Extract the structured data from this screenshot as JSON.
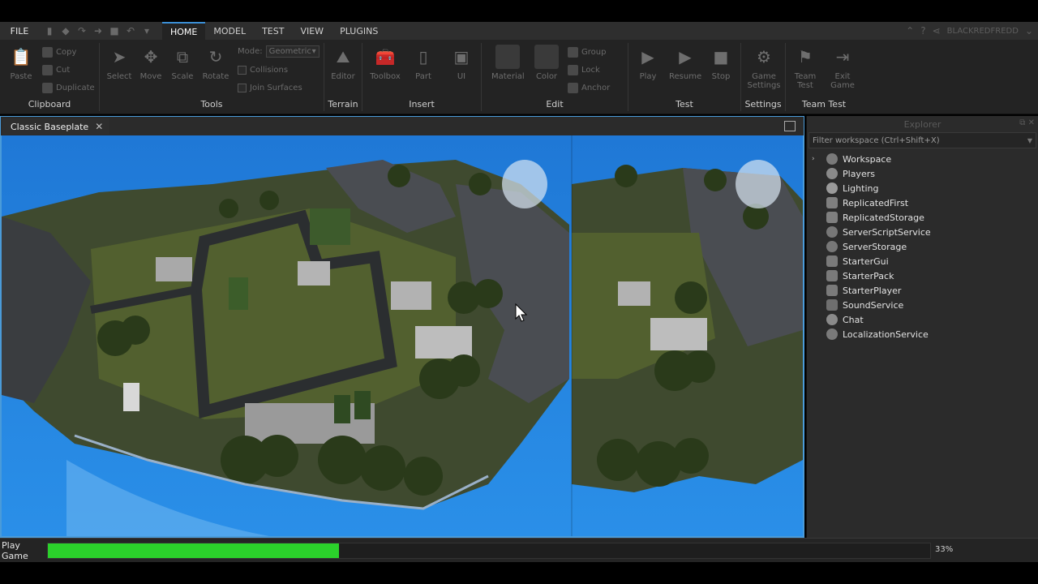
{
  "menubar": {
    "file": "FILE",
    "tabs": [
      {
        "label": "HOME",
        "active": true
      },
      {
        "label": "MODEL"
      },
      {
        "label": "TEST"
      },
      {
        "label": "VIEW"
      },
      {
        "label": "PLUGINS"
      }
    ],
    "username": "BLACKREDFREDD"
  },
  "ribbon": {
    "clipboard": {
      "label": "Clipboard",
      "paste": "Paste",
      "copy": "Copy",
      "cut": "Cut",
      "duplicate": "Duplicate"
    },
    "tools": {
      "label": "Tools",
      "select": "Select",
      "move": "Move",
      "scale": "Scale",
      "rotate": "Rotate",
      "mode_label": "Mode:",
      "mode_value": "Geometric",
      "collisions": "Collisions",
      "join_surfaces": "Join Surfaces"
    },
    "terrain": {
      "label": "Terrain",
      "editor": "Editor"
    },
    "insert": {
      "label": "Insert",
      "toolbox": "Toolbox",
      "part": "Part",
      "ui": "UI"
    },
    "edit": {
      "label": "Edit",
      "material": "Material",
      "color": "Color",
      "group": "Group",
      "lock": "Lock",
      "anchor": "Anchor"
    },
    "test": {
      "label": "Test",
      "play": "Play",
      "resume": "Resume",
      "stop": "Stop"
    },
    "settings": {
      "label": "Settings",
      "game_settings_1": "Game",
      "game_settings_2": "Settings"
    },
    "team_test": {
      "label": "Team Test",
      "team_test_1": "Team",
      "team_test_2": "Test",
      "exit_game_1": "Exit",
      "exit_game_2": "Game"
    }
  },
  "viewport": {
    "tab_title": "Classic Baseplate"
  },
  "explorer": {
    "title": "Explorer",
    "filter_placeholder": "Filter workspace (Ctrl+Shift+X)",
    "items": [
      {
        "label": "Workspace",
        "expandable": true,
        "icon": "globe-icon"
      },
      {
        "label": "Players",
        "icon": "players-icon"
      },
      {
        "label": "Lighting",
        "icon": "lightbulb-icon"
      },
      {
        "label": "ReplicatedFirst",
        "icon": "replicated-icon"
      },
      {
        "label": "ReplicatedStorage",
        "icon": "replicated-icon"
      },
      {
        "label": "ServerScriptService",
        "icon": "server-script-icon"
      },
      {
        "label": "ServerStorage",
        "icon": "server-storage-icon"
      },
      {
        "label": "StarterGui",
        "icon": "starter-gui-icon"
      },
      {
        "label": "StarterPack",
        "icon": "starter-pack-icon"
      },
      {
        "label": "StarterPlayer",
        "icon": "starter-player-icon"
      },
      {
        "label": "SoundService",
        "icon": "sound-icon"
      },
      {
        "label": "Chat",
        "icon": "chat-icon"
      },
      {
        "label": "LocalizationService",
        "icon": "localization-icon"
      }
    ]
  },
  "statusbar": {
    "label": "Play Game",
    "progress": 0.33,
    "progress_text": "33%",
    "fill_color": "#2bd12b"
  }
}
